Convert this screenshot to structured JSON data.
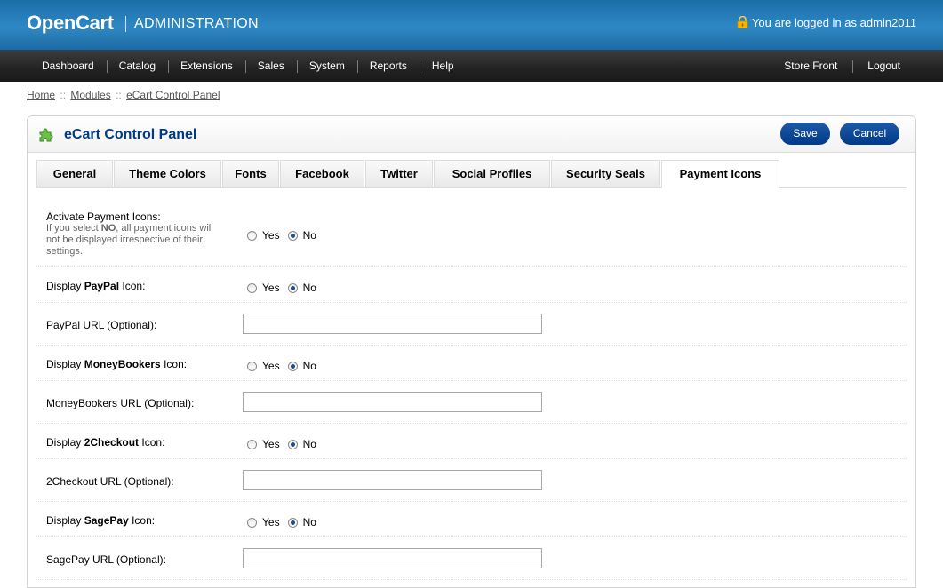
{
  "header": {
    "logo": "OpenCart",
    "section": "ADMINISTRATION",
    "login_text": "You are logged in as admin2011"
  },
  "menu": {
    "left": [
      "Dashboard",
      "Catalog",
      "Extensions",
      "Sales",
      "System",
      "Reports",
      "Help"
    ],
    "right": [
      "Store Front",
      "Logout"
    ]
  },
  "breadcrumb": [
    "Home",
    "Modules",
    "eCart Control Panel"
  ],
  "breadcrumb_separator": "::",
  "panel": {
    "title": "eCart Control Panel",
    "save_label": "Save",
    "cancel_label": "Cancel"
  },
  "tabs": [
    "General",
    "Theme Colors",
    "Fonts",
    "Facebook",
    "Twitter",
    "Social Profiles",
    "Security Seals",
    "Payment Icons"
  ],
  "active_tab": "Payment Icons",
  "form": {
    "activate": {
      "label": "Activate Payment Icons:",
      "help_pre": "If you select ",
      "help_bold": "NO",
      "help_post": ", all payment icons will not be displayed irrespective of their settings."
    },
    "yes_label": "Yes",
    "no_label": "No",
    "display_prefix": "Display",
    "display_suffix": "Icon:",
    "rows": [
      {
        "brand": "PayPal",
        "url_label": "PayPal URL (Optional):",
        "url_value": ""
      },
      {
        "brand": "MoneyBookers",
        "url_label": "MoneyBookers URL (Optional):",
        "url_value": ""
      },
      {
        "brand": "2Checkout",
        "url_label": "2Checkout URL (Optional):",
        "url_value": ""
      },
      {
        "brand": "SagePay",
        "url_label": "SagePay URL (Optional):",
        "url_value": ""
      }
    ],
    "selected": "No"
  },
  "colors": {
    "header_blue": "#1f75b0",
    "title_blue": "#003a88",
    "button_blue": "#0a4a96"
  },
  "icons": {
    "login": "lock-icon",
    "panel": "puzzle-icon"
  }
}
